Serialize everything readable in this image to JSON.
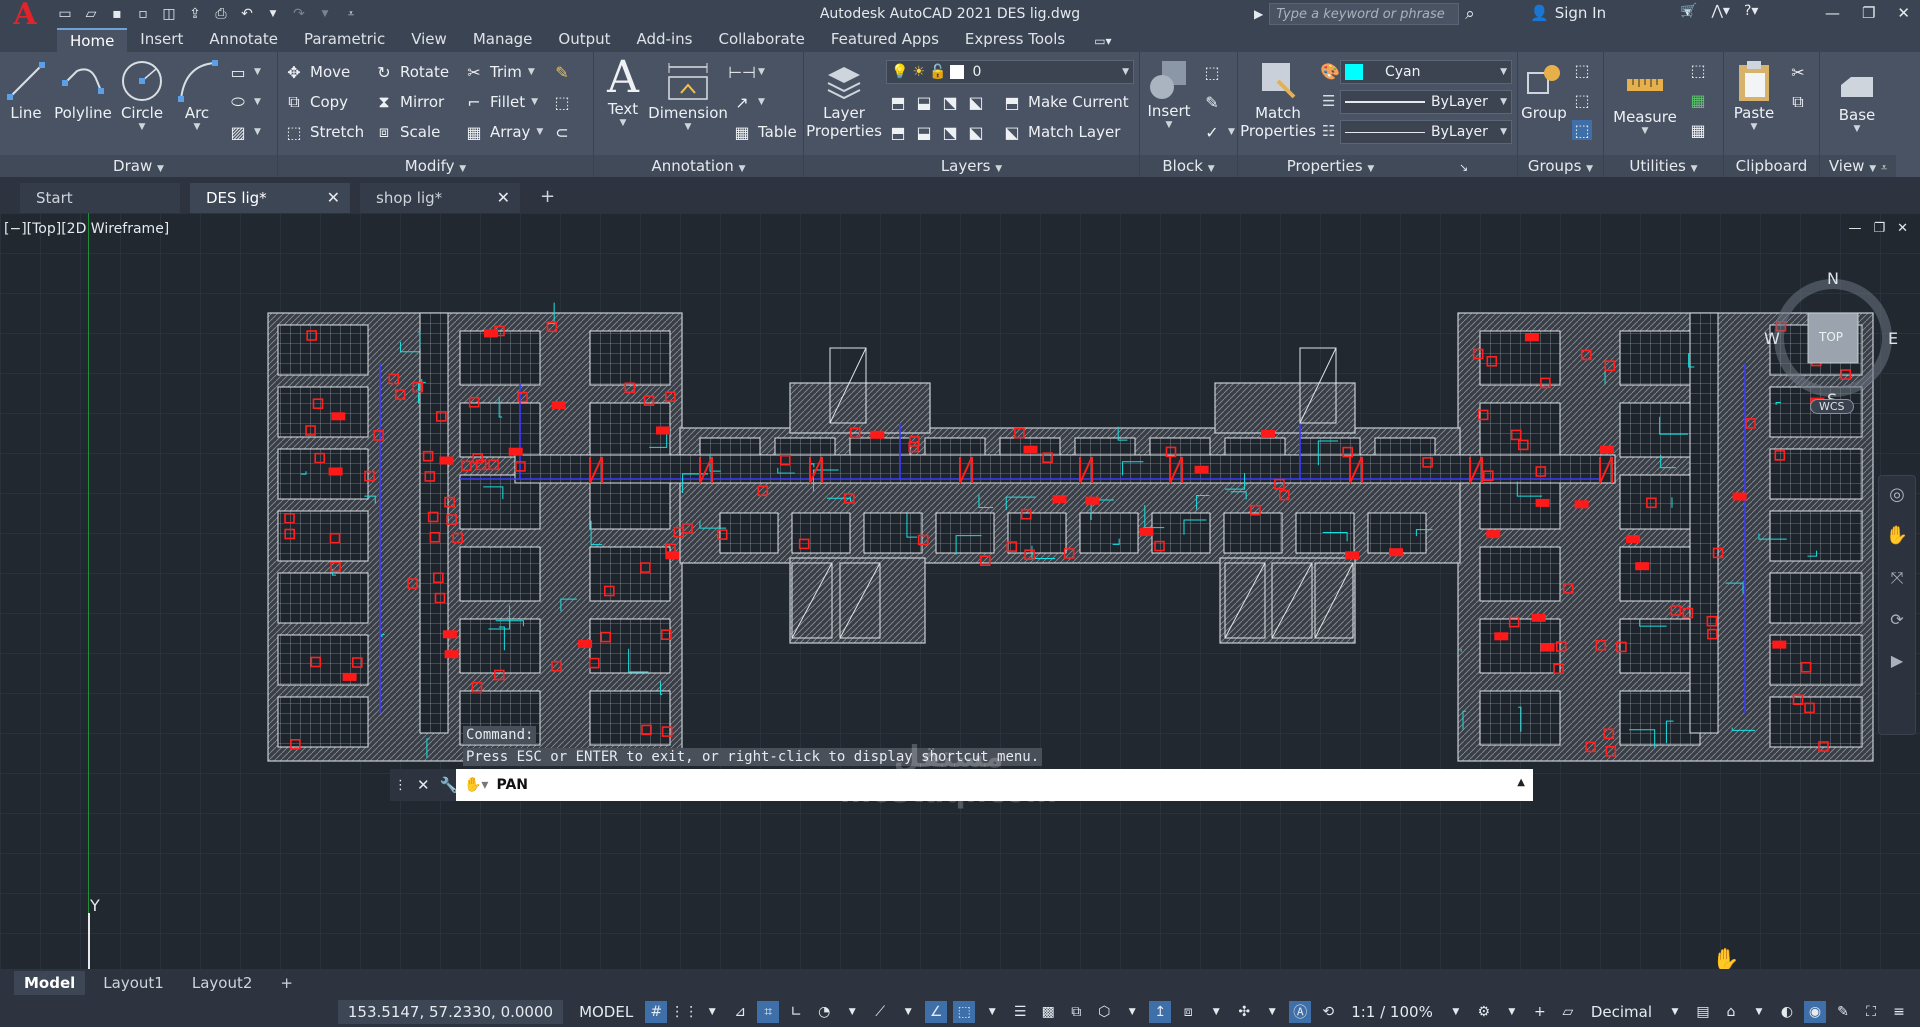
{
  "titlebar": {
    "app_logo": "A",
    "title": "Autodesk AutoCAD 2021   DES  lig.dwg",
    "search_placeholder": "Type a keyword or phrase",
    "sign_in": "Sign In"
  },
  "ribbon_tabs": [
    "Home",
    "Insert",
    "Annotate",
    "Parametric",
    "View",
    "Manage",
    "Output",
    "Add-ins",
    "Collaborate",
    "Featured Apps",
    "Express Tools"
  ],
  "panels": {
    "draw": {
      "title": "Draw",
      "line": "Line",
      "polyline": "Polyline",
      "circle": "Circle",
      "arc": "Arc"
    },
    "modify": {
      "title": "Modify",
      "move": "Move",
      "rotate": "Rotate",
      "trim": "Trim",
      "copy": "Copy",
      "mirror": "Mirror",
      "fillet": "Fillet",
      "stretch": "Stretch",
      "scale": "Scale",
      "array": "Array"
    },
    "annotation": {
      "title": "Annotation",
      "text": "Text",
      "dimension": "Dimension",
      "table": "Table"
    },
    "layers": {
      "title": "Layers",
      "layer_properties_1": "Layer",
      "layer_properties_2": "Properties",
      "current_layer": "0",
      "make_current": "Make Current",
      "match_layer": "Match Layer"
    },
    "block": {
      "title": "Block",
      "insert": "Insert"
    },
    "properties": {
      "title": "Properties",
      "match_1": "Match",
      "match_2": "Properties",
      "color": "Cyan",
      "linetype": "ByLayer",
      "lineweight": "ByLayer"
    },
    "groups": {
      "title": "Groups",
      "group": "Group"
    },
    "utilities": {
      "title": "Utilities",
      "measure": "Measure"
    },
    "clipboard": {
      "title": "Clipboard",
      "paste": "Paste"
    },
    "view": {
      "title": "View",
      "base": "Base"
    }
  },
  "doc_tabs": [
    {
      "label": "Start"
    },
    {
      "label": "DES  lig*"
    },
    {
      "label": "shop lig*"
    }
  ],
  "viewport": {
    "label": "[−][Top][2D Wireframe]",
    "compass_n": "N",
    "compass_s": "S",
    "compass_e": "E",
    "compass_w": "W",
    "cube_face": "TOP",
    "wcs": "WCS",
    "ucs_y": "Y"
  },
  "command": {
    "history_1": "Command:",
    "history_2": "Press ESC or ENTER to exit, or right-click to display shortcut menu.",
    "current": "PAN"
  },
  "watermark": {
    "line1": "مستقل",
    "line2": "mostaql.com"
  },
  "layout_tabs": [
    "Model",
    "Layout1",
    "Layout2"
  ],
  "status": {
    "coords": "153.5147, 57.2330, 0.0000",
    "model": "MODEL",
    "scale": "1:1 / 100%",
    "units": "Decimal"
  },
  "colors": {
    "accent": "#3e6fa8",
    "cyan_swatch": "#00ffff",
    "title_bg": "#3b4453",
    "ribbon_bg": "#4a5364"
  }
}
